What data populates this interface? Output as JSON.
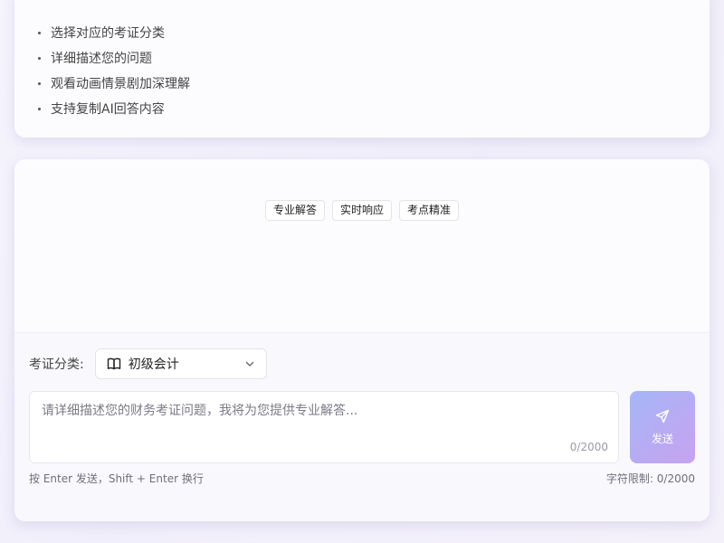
{
  "tips": {
    "items": [
      "选择对应的考证分类",
      "详细描述您的问题",
      "观看动画情景剧加深理解",
      "支持复制AI回答内容"
    ]
  },
  "chat": {
    "feature_tags": [
      "专业解答",
      "实时响应",
      "考点精准"
    ]
  },
  "input": {
    "category_label": "考证分类:",
    "category_value": "初级会计",
    "category_icon": "book-icon",
    "placeholder": "请详细描述您的财务考证问题，我将为您提供专业解答...",
    "value": "",
    "counter": "0/2000",
    "send_label": "发送",
    "send_icon": "send-icon",
    "hint_left": "按 Enter 发送，Shift + Enter 换行",
    "hint_right": "字符限制: 0/2000"
  },
  "colors": {
    "send_gradient_start": "#a6b6f8",
    "send_gradient_end": "#c7a2f0"
  }
}
